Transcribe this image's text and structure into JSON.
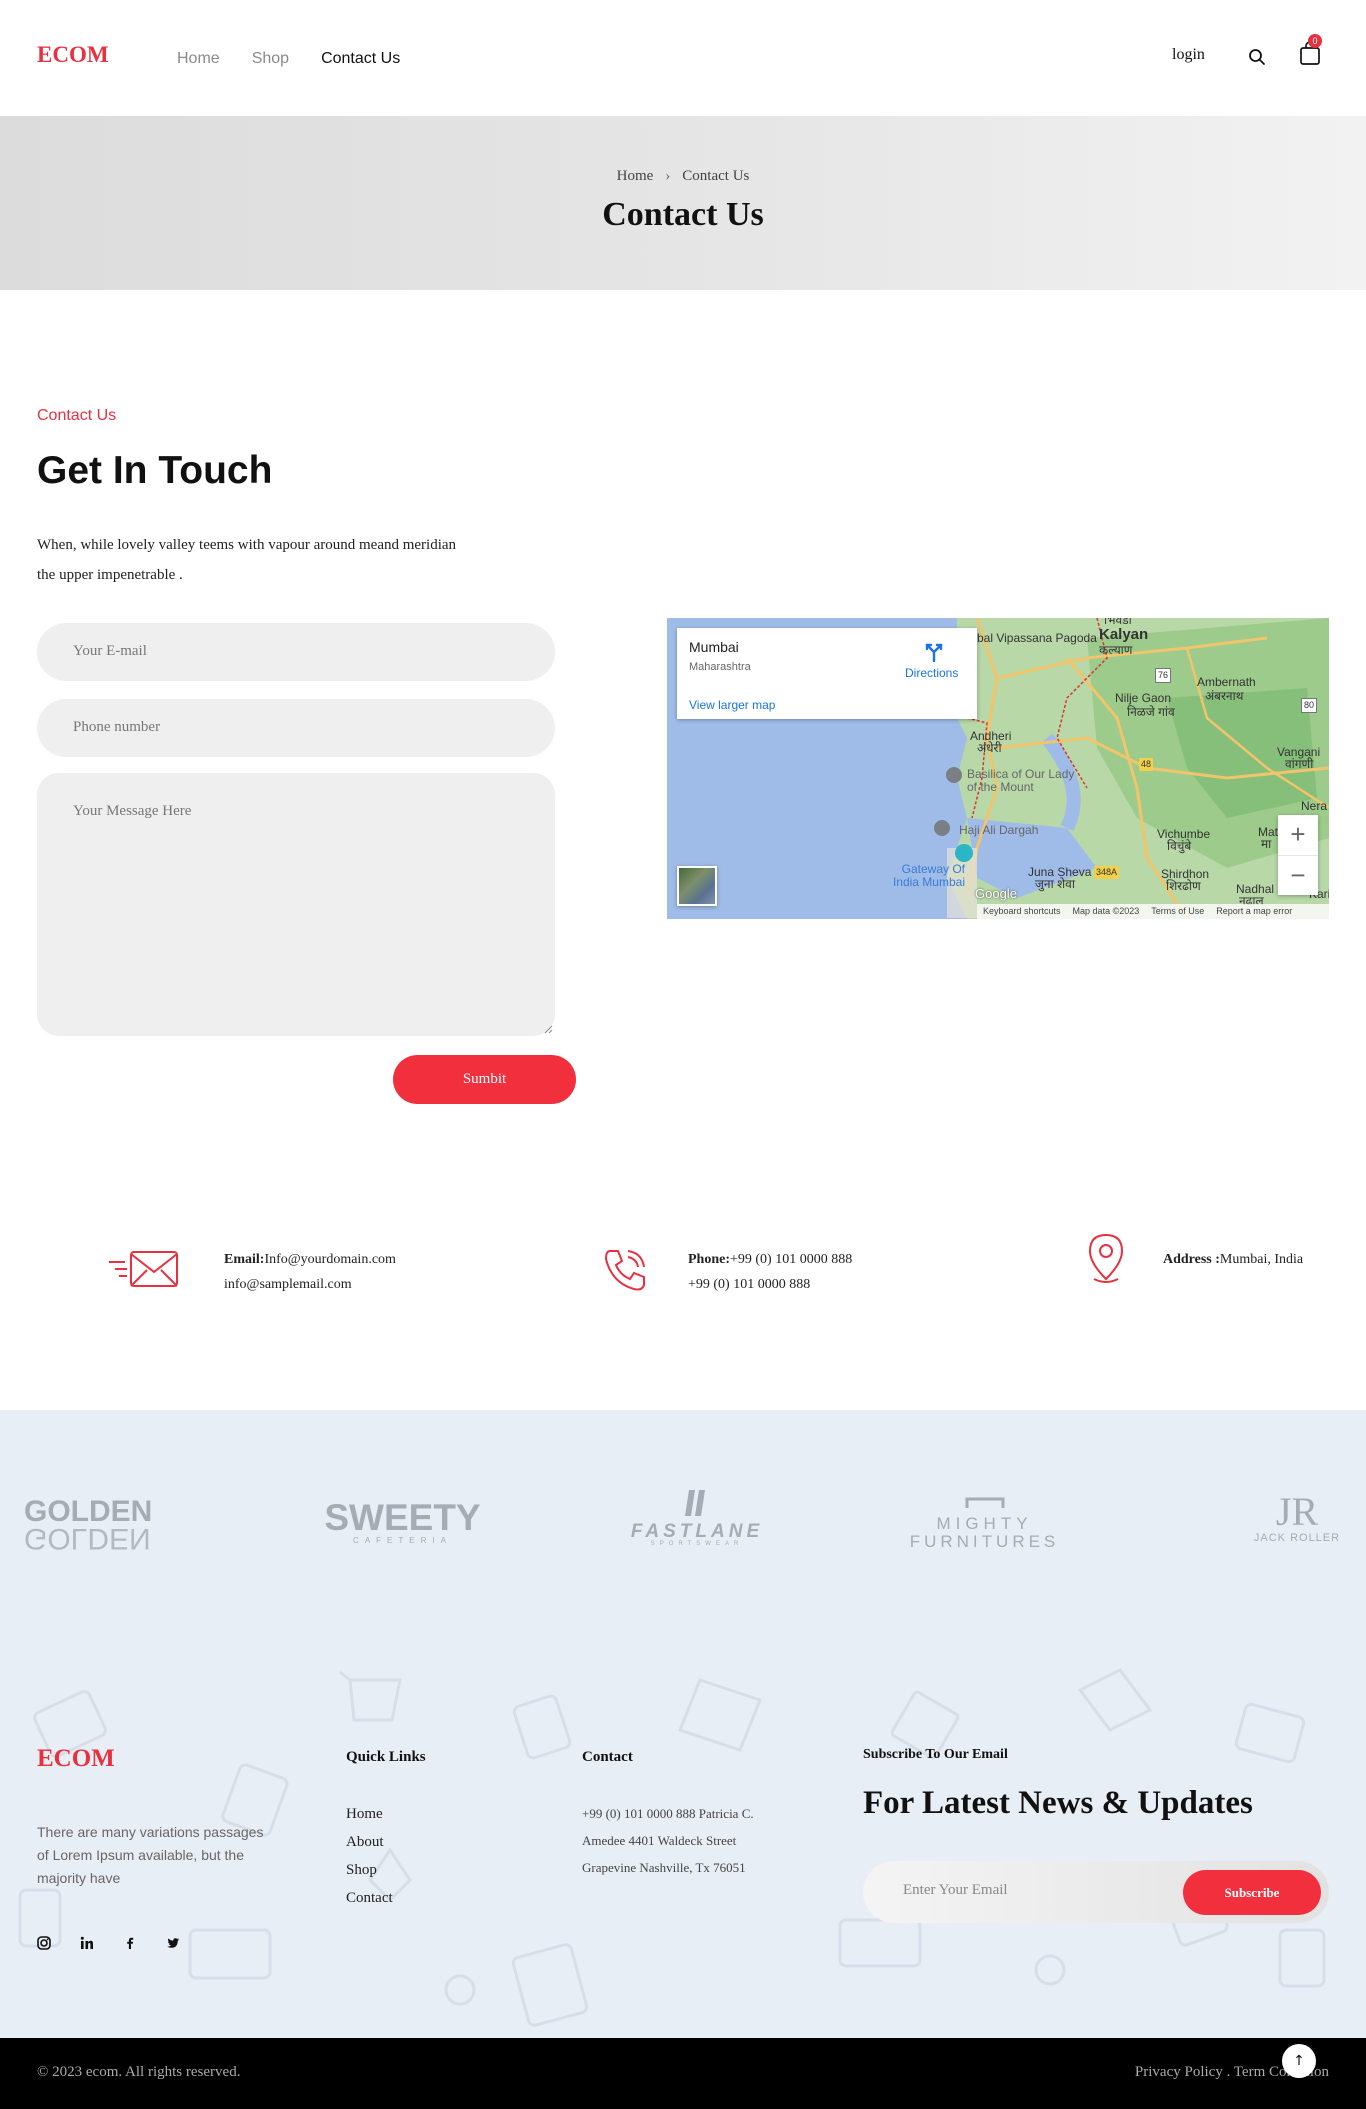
{
  "header": {
    "logo": "ECOM",
    "nav": [
      {
        "label": "Home",
        "active": false
      },
      {
        "label": "Shop",
        "active": false
      },
      {
        "label": "Contact Us",
        "active": true
      }
    ],
    "login_label": "login",
    "search_icon": "search-icon",
    "cart_icon": "shopping-bag-icon",
    "cart_count": "0"
  },
  "banner": {
    "breadcrumb": [
      "Home",
      "Contact Us"
    ],
    "title": "Contact Us"
  },
  "contact": {
    "kicker": "Contact Us",
    "title": "Get In Touch",
    "description": "When, while lovely valley teems with vapour around meand meridian the upper impenetrable .",
    "email_placeholder": "Your E-mail",
    "phone_placeholder": "Phone number",
    "message_placeholder": "Your Message Here",
    "submit_label": "Sumbit"
  },
  "map": {
    "place": "Mumbai",
    "region": "Maharashtra",
    "directions_label": "Directions",
    "larger_map_label": "View larger map",
    "labels": {
      "bhiwandi": "भिवंडी",
      "vipassana": "bal Vipassana Pagoda",
      "kalyan": "Kalyan",
      "kalyan_local": "कल्याण",
      "ambernath": "Ambernath",
      "ambernath_local": "अंबरनाथ",
      "nilje": "Nilje Gaon",
      "nilje_local": "निळजे गांव",
      "andheri": "Andheri",
      "andheri_local": "अंधेरी",
      "vangani": "Vangani",
      "vangani_local": "वांगणी",
      "basilica": "Basilica of Our Lady of the Mount",
      "haji_ali": "Haji Ali Dargah",
      "nera": "Nera",
      "vichumbe": "Vichumbe",
      "vichumbe_local": "विचुंबे",
      "mat": "Mat",
      "mat_local": "मा",
      "gateway": "Gateway Of India Mumbai",
      "juna_sheva": "Juna Sheva",
      "juna_sheva_local": "जुना शेवा",
      "shirdhon": "Shirdhon",
      "shirdhon_local": "शिरढोण",
      "nadhal": "Nadhal",
      "nadhal_local": "नढाल",
      "kari": "Kari",
      "road_76": "76",
      "road_80": "80",
      "road_48": "48",
      "road_348a": "348A"
    },
    "google": "Google",
    "attribution": [
      "Keyboard shortcuts",
      "Map data ©2023",
      "Terms of Use",
      "Report a map error"
    ],
    "zoom_in": "+",
    "zoom_out": "−"
  },
  "info": {
    "email_label": "Email:",
    "email_primary": "Info@yourdomain.com",
    "email_secondary": "info@samplemail.com",
    "phone_label": "Phone:",
    "phone_primary": "+99 (0) 101 0000 888",
    "phone_secondary": "+99 (0) 101 0000 888",
    "address_label": "Address :",
    "address_value": "Mumbai, India"
  },
  "brands": {
    "golden": "GOLDEN",
    "sweety": "SWEETY",
    "sweety_sub": "CAFETERIA",
    "fastlane": "FASTLANE",
    "fastlane_sub": "SPORTSWEAR",
    "mighty": "MIGHTY",
    "mighty_sub": "FURNITURES",
    "jr": "JR",
    "jr_sub": "JACK ROLLER"
  },
  "footer": {
    "logo": "ECOM",
    "description": "There are many variations passages of Lorem Ipsum available, but the majority have",
    "socials": [
      "instagram-icon",
      "linkedin-icon",
      "facebook-icon",
      "twitter-icon"
    ],
    "quick_links_heading": "Quick Links",
    "quick_links": [
      "Home",
      "About",
      "Shop",
      "Contact"
    ],
    "contact_heading": "Contact",
    "contact_lines": [
      "+99 (0) 101 0000 888 Patricia C.",
      "Amedee 4401 Waldeck Street",
      "Grapevine Nashville, Tx 76051"
    ],
    "subscribe_kicker": "Subscribe To Our Email",
    "subscribe_title": "For Latest News & Updates",
    "subscribe_placeholder": "Enter Your Email",
    "subscribe_button": "Subscribe",
    "copyright": "© 2023 ecom. All rights reserved.",
    "policy": "Privacy Policy . Term Condition",
    "scroll_top": "↑"
  },
  "colors": {
    "accent": "#f2303d",
    "logo": "#e8303f",
    "footer_bg": "#e8eef5",
    "bottom_bar": "#000000"
  }
}
